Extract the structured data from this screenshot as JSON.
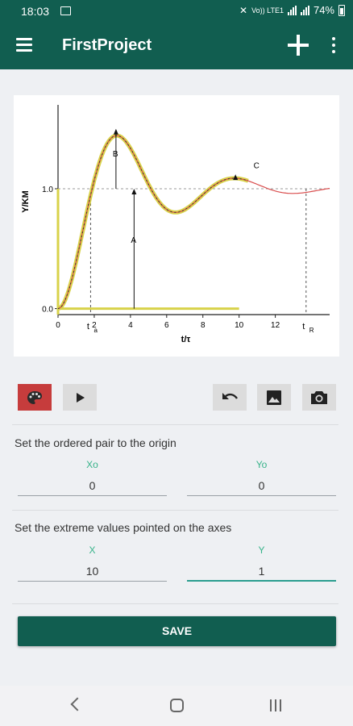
{
  "status_bar": {
    "time": "18:03",
    "network": "Vo)) LTE1",
    "battery_percent": "74%"
  },
  "app_bar": {
    "title": "FirstProject"
  },
  "chart_data": {
    "type": "line",
    "xlabel": "t/τ",
    "ylabel": "Y/KM",
    "xlim": [
      0,
      15
    ],
    "ylim": [
      -0.05,
      1.7
    ],
    "x_ticks": [
      "0",
      "2",
      "4",
      "6",
      "8",
      "10",
      "12"
    ],
    "x_tick_values": [
      0,
      2,
      4,
      6,
      8,
      10,
      12
    ],
    "extra_x_ticks": [
      {
        "label": "t",
        "sub": "a",
        "x": 1.8
      },
      {
        "label": "t",
        "sub": "R",
        "x": 13.7
      }
    ],
    "y_ticks": [
      "0.0",
      "1.0"
    ],
    "y_tick_values": [
      0,
      1
    ],
    "reference_line": 1.0,
    "annotations": [
      {
        "text": "A",
        "x": 4.2,
        "y": 0.55
      },
      {
        "text": "B",
        "x": 3.2,
        "y": 1.27
      },
      {
        "text": "C",
        "x": 10.8,
        "y": 1.17
      }
    ],
    "peaks": {
      "first": {
        "x": 3.2,
        "y": 1.5
      },
      "second": {
        "x": 9.8,
        "y": 1.12
      }
    },
    "series": [
      {
        "values_fn": "damped_second_order",
        "zeta": 0.25,
        "omega": 1.0
      }
    ],
    "grid": false,
    "legend": "none"
  },
  "controls": {
    "palette_icon": "palette-icon",
    "play_icon": "play-icon",
    "undo_icon": "undo-icon",
    "image_icon": "image-icon",
    "camera_icon": "camera-icon",
    "palette_color": "#c63c3c"
  },
  "origin_section": {
    "title": "Set the ordered pair to the origin",
    "xo_label": "Xo",
    "xo_value": "0",
    "yo_label": "Yo",
    "yo_value": "0"
  },
  "extreme_section": {
    "title": "Set the extreme values pointed on the axes",
    "x_label": "X",
    "x_value": "10",
    "y_label": "Y",
    "y_value": "1"
  },
  "save_label": "SAVE",
  "colors": {
    "primary": "#115e50",
    "accent": "#38b38a",
    "curve_highlight": "#d8d24a",
    "curve": "#d94d4d"
  }
}
